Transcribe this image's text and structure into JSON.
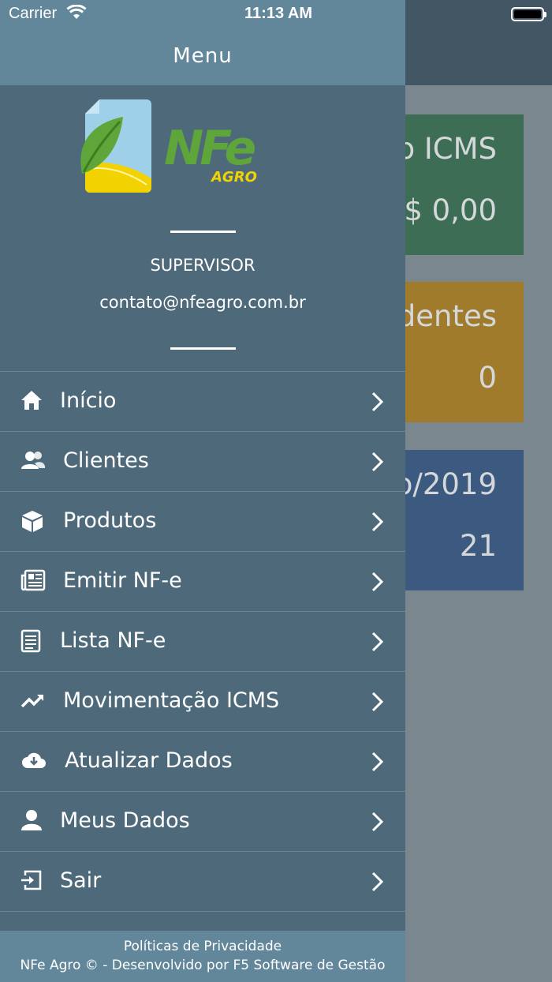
{
  "status_bar": {
    "carrier": "Carrier",
    "time": "11:13 AM"
  },
  "background": {
    "cards": [
      {
        "title": "o ICMS",
        "value": "$ 0,00",
        "color": "#3d6d54"
      },
      {
        "title": "dentes",
        "value": "0",
        "color": "#a07b2c"
      },
      {
        "title": "o/2019",
        "value": "21",
        "color": "#3c5a80"
      }
    ]
  },
  "drawer": {
    "title": "Menu",
    "logo": {
      "text": "NFe",
      "subtext": "AGRO"
    },
    "user": {
      "role": "SUPERVISOR",
      "email": "contato@nfeagro.com.br"
    },
    "items": [
      {
        "label": "Início",
        "icon": "home-icon"
      },
      {
        "label": "Clientes",
        "icon": "users-icon"
      },
      {
        "label": "Produtos",
        "icon": "cube-icon"
      },
      {
        "label": "Emitir NF-e",
        "icon": "newspaper-icon"
      },
      {
        "label": "Lista NF-e",
        "icon": "document-list-icon"
      },
      {
        "label": "Movimentação ICMS",
        "icon": "trending-up-icon"
      },
      {
        "label": "Atualizar Dados",
        "icon": "cloud-download-icon"
      },
      {
        "label": "Meus Dados",
        "icon": "user-icon"
      },
      {
        "label": "Sair",
        "icon": "sign-out-icon"
      }
    ],
    "footer": {
      "privacy": "Políticas de Privacidade",
      "credits": "NFe Agro © - Desenvolvido por F5 Software de Gestão"
    }
  },
  "colors": {
    "drawer_bg": "#4e6a7a",
    "drawer_header": "#62879a",
    "logo_green": "#5fa63a",
    "logo_yellow": "#f2d200",
    "logo_blue": "#9fd0ea"
  }
}
